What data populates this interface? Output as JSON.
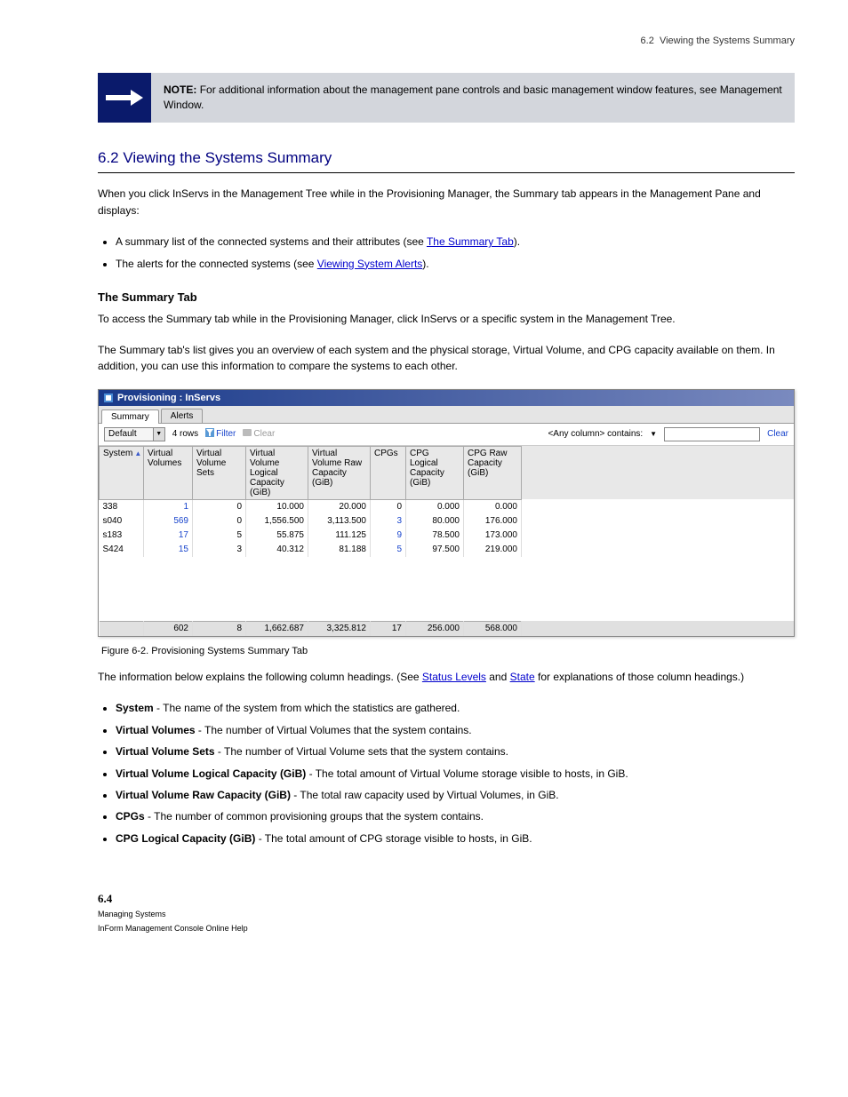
{
  "header": {
    "section_id": "6.2",
    "section_title": "Viewing the Systems Summary"
  },
  "note": {
    "label": "NOTE:",
    "text": "For additional information about the management pane controls and basic management window features, see Management Window."
  },
  "mainHeading": "6.2 Viewing the Systems Summary",
  "introText": "When you click InServs in the Management Tree while in the Provisioning Manager, the Summary tab appears in the Management Pane and displays:",
  "bullets": [
    {
      "text": "A summary list of the connected systems and their attributes (see ",
      "linkText": "The Summary Tab",
      "after": ")."
    },
    {
      "text": "The alerts for the connected systems (see ",
      "linkText": "Viewing System Alerts",
      "after": ")."
    }
  ],
  "subHeading": "The Summary Tab",
  "summaryIntro": "To access the Summary tab while in the Provisioning Manager, click InServs or a specific system in the Management Tree.",
  "summaryDesc": "The Summary tab's list gives you an overview of each system and the physical storage, Virtual Volume, and CPG capacity available on them. In addition, you can use this information to compare the systems to each other.",
  "figure": {
    "title": "Provisioning : InServs",
    "tabs": [
      "Summary",
      "Alerts"
    ],
    "activeTab": 0,
    "defaultSelect": "Default",
    "rowCount": "4 rows",
    "filterLabel": "Filter",
    "clearToolbarLabel": "Clear",
    "searchLabel": "<Any column> contains:",
    "clearLabel": "Clear",
    "columns": [
      "System",
      "Virtual Volumes",
      "Virtual Volume Sets",
      "Virtual Volume Logical Capacity (GiB)",
      "Virtual Volume Raw Capacity (GiB)",
      "CPGs",
      "CPG Logical Capacity (GiB)",
      "CPG Raw Capacity (GiB)"
    ],
    "rows": [
      {
        "system": "338",
        "vv": "1",
        "vvsets": "0",
        "vvlog": "10.000",
        "vvrraw": "20.000",
        "cpgs": "0",
        "cpglog": "0.000",
        "cpgraw": "0.000"
      },
      {
        "system": "s040",
        "vv": "569",
        "vvsets": "0",
        "vvlog": "1,556.500",
        "vvrraw": "3,113.500",
        "cpgs": "3",
        "cpglog": "80.000",
        "cpgraw": "176.000"
      },
      {
        "system": "s183",
        "vv": "17",
        "vvsets": "5",
        "vvlog": "55.875",
        "vvrraw": "111.125",
        "cpgs": "9",
        "cpglog": "78.500",
        "cpgraw": "173.000"
      },
      {
        "system": "S424",
        "vv": "15",
        "vvsets": "3",
        "vvlog": "40.312",
        "vvrraw": "81.188",
        "cpgs": "5",
        "cpglog": "97.500",
        "cpgraw": "219.000"
      }
    ],
    "totals": {
      "vv": "602",
      "vvsets": "8",
      "vvlog": "1,662.687",
      "vvrraw": "3,325.812",
      "cpgs": "17",
      "cpglog": "256.000",
      "cpgraw": "568.000"
    }
  },
  "figureCaption": "Figure 6-2.  Provisioning Systems Summary Tab",
  "afterFigure": {
    "pre": "The information below explains the following column headings. (See ",
    "link1": "Status Levels",
    "mid": " and ",
    "link2": "State",
    "post": " for explanations of those column headings.)"
  },
  "defs": [
    {
      "term": "System",
      "def": " - The name of the system from which the statistics are gathered."
    },
    {
      "term": "Virtual Volumes",
      "def": " - The number of Virtual Volumes that the system contains."
    },
    {
      "term": "Virtual Volume Sets",
      "def": " - The number of Virtual Volume sets that the system contains."
    },
    {
      "term": "Virtual Volume Logical Capacity (GiB)",
      "def": " - The total amount of Virtual Volume storage visible to hosts, in GiB."
    },
    {
      "term": "Virtual Volume Raw Capacity (GiB)",
      "def": " - The total raw capacity used by Virtual Volumes, in GiB."
    },
    {
      "term": "CPGs",
      "def": " - The number of common provisioning groups that the system contains."
    },
    {
      "term": "CPG Logical Capacity (GiB)",
      "def": " - The total amount of CPG storage visible to hosts, in GiB."
    }
  ],
  "pageNumber": "6.4",
  "footerLine1": "Managing Systems",
  "footerLine2": "InForm Management Console Online Help"
}
